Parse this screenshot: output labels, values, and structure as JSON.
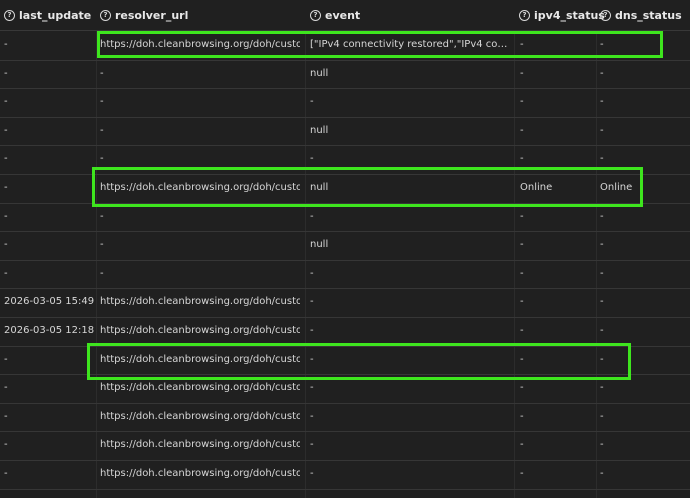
{
  "columns": [
    {
      "key": "last_update",
      "label": "last_update"
    },
    {
      "key": "resolver_url",
      "label": "resolver_url"
    },
    {
      "key": "event",
      "label": "event"
    },
    {
      "key": "ipv4_status",
      "label": "ipv4_status"
    },
    {
      "key": "dns_status",
      "label": "dns_status"
    }
  ],
  "help_glyph": "?",
  "rows": [
    [
      "-",
      "https://doh.cleanbrowsing.org/doh/custo...",
      "[\"IPv4 connectivity restored\",\"IPv4 conn...",
      "-",
      "-"
    ],
    [
      "-",
      "-",
      "null",
      "-",
      "-"
    ],
    [
      "-",
      "-",
      "-",
      "-",
      "-"
    ],
    [
      "-",
      "-",
      "null",
      "-",
      "-"
    ],
    [
      "-",
      "-",
      "-",
      "-",
      "-"
    ],
    [
      "-",
      "https://doh.cleanbrowsing.org/doh/custo...",
      "null",
      "Online",
      "Online"
    ],
    [
      "-",
      "-",
      "-",
      "-",
      "-"
    ],
    [
      "-",
      "-",
      "null",
      "-",
      "-"
    ],
    [
      "-",
      "-",
      "-",
      "-",
      "-"
    ],
    [
      "2026-03-05 15:49",
      "https://doh.cleanbrowsing.org/doh/custo...",
      "-",
      "-",
      "-"
    ],
    [
      "2026-03-05 12:18",
      "https://doh.cleanbrowsing.org/doh/custo...",
      "-",
      "-",
      "-"
    ],
    [
      "-",
      "https://doh.cleanbrowsing.org/doh/custo...",
      "-",
      "-",
      "-"
    ],
    [
      "-",
      "https://doh.cleanbrowsing.org/doh/custo...",
      "-",
      "-",
      "-"
    ],
    [
      "-",
      "https://doh.cleanbrowsing.org/doh/custo...",
      "-",
      "-",
      "-"
    ],
    [
      "-",
      "https://doh.cleanbrowsing.org/doh/custo...",
      "-",
      "-",
      "-"
    ],
    [
      "-",
      "https://doh.cleanbrowsing.org/doh/custo...",
      "-",
      "-",
      "-"
    ]
  ],
  "colors": {
    "background": "#202020",
    "highlight": "#3ee51e",
    "text": "#d6d6d6"
  }
}
